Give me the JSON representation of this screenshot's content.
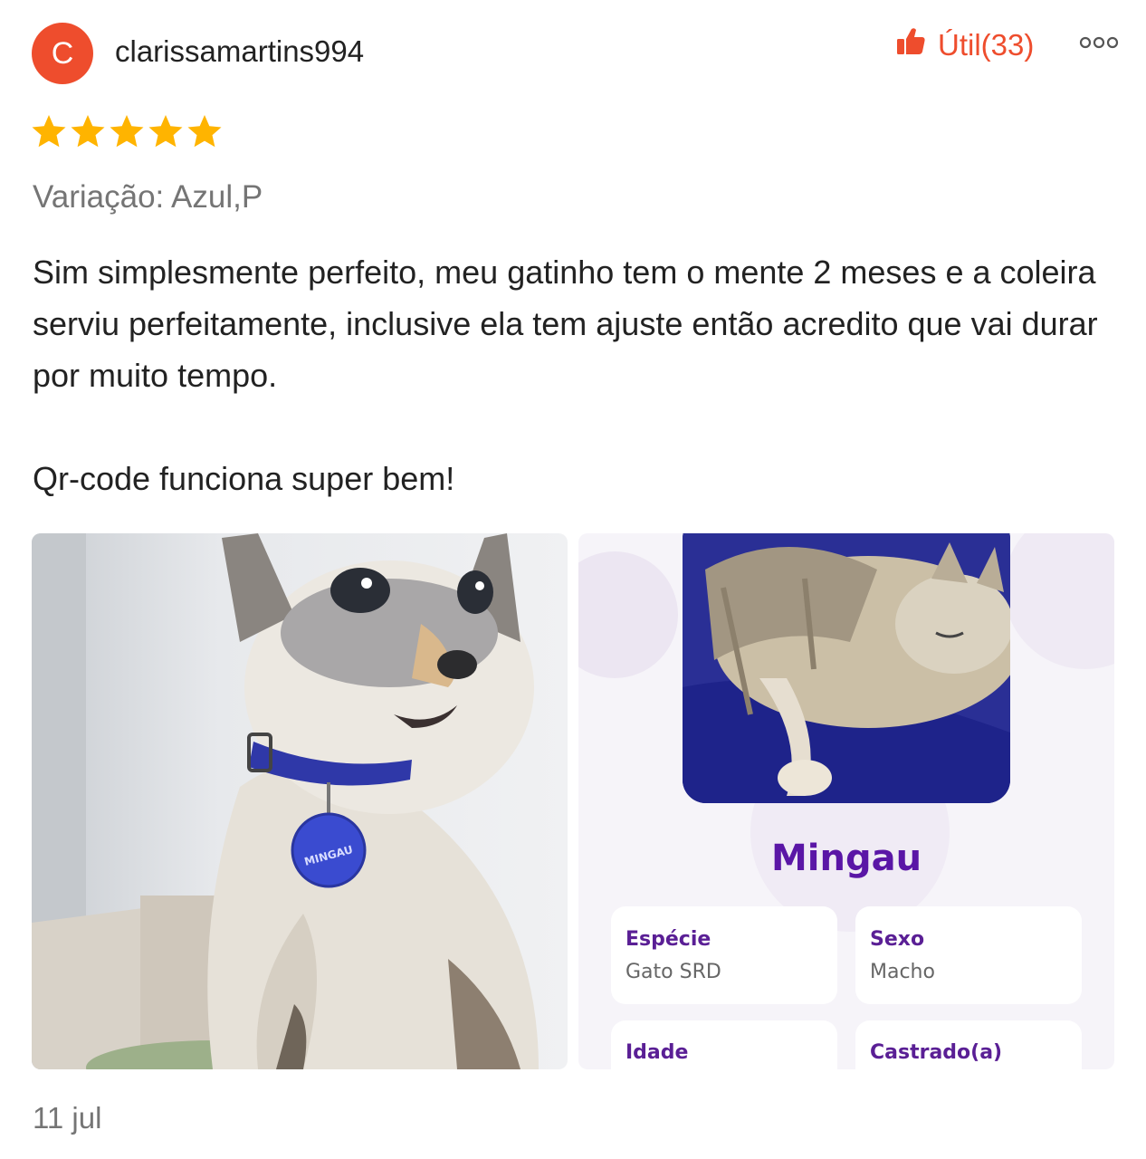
{
  "reviewer": {
    "avatar_initial": "C",
    "username": "clarissamartins994",
    "avatar_color": "#ee4d2d"
  },
  "actions": {
    "helpful_label": "Útil(33)",
    "helpful_icon": "thumbs-up-icon",
    "more_icon": "more-options-icon",
    "accent_color": "#ee4d2d"
  },
  "rating": {
    "stars": 5,
    "max": 5,
    "star_color": "#ffb400"
  },
  "variation": "Variação: Azul,P",
  "review": {
    "paragraph1": "Sim simplesmente perfeito, meu gatinho tem o mente 2 meses e a coleira serviu perfeitamente, inclusive ela tem ajuste então acredito que vai durar por muito tempo.",
    "paragraph2": "Qr-code funciona super bem!"
  },
  "photos": {
    "photo1": {
      "tag_text": "MINGAU"
    },
    "photo2": {
      "pet_name": "Mingau",
      "fields": [
        {
          "label": "Espécie",
          "value": "Gato SRD"
        },
        {
          "label": "Sexo",
          "value": "Macho"
        },
        {
          "label": "Idade",
          "value": ""
        },
        {
          "label": "Castrado(a)",
          "value": ""
        }
      ]
    }
  },
  "date": "11 jul"
}
